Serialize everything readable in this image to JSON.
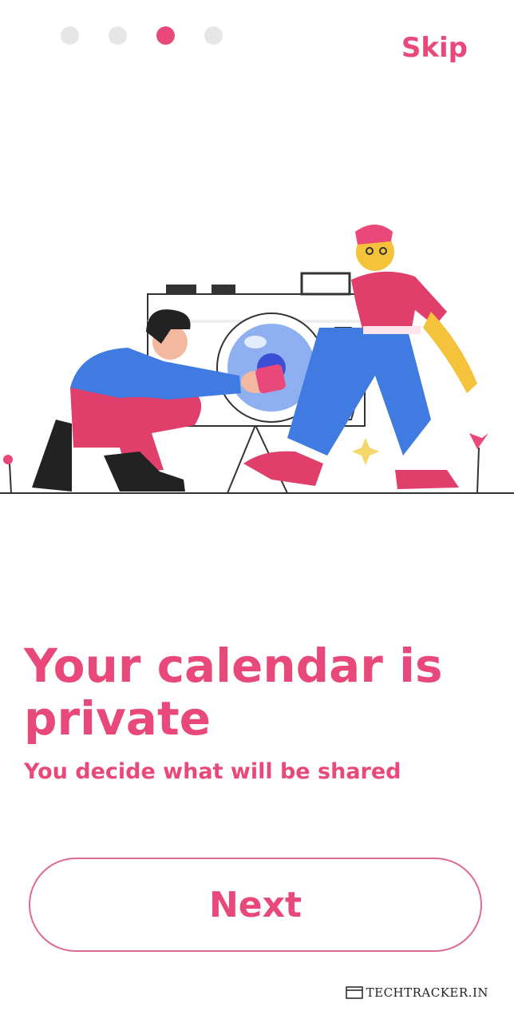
{
  "pager": {
    "count": 4,
    "active_index": 2
  },
  "skip_label": "Skip",
  "title": "Your calendar is private",
  "subtitle": "You decide what will be shared",
  "next_label": "Next",
  "watermark": "TECHTRACKER.IN",
  "colors": {
    "accent": "#e8497a",
    "dot_inactive": "#e6e6e6",
    "blue": "#3f7be0",
    "pink_dark": "#e03f6b",
    "yellow": "#f5c33b"
  }
}
